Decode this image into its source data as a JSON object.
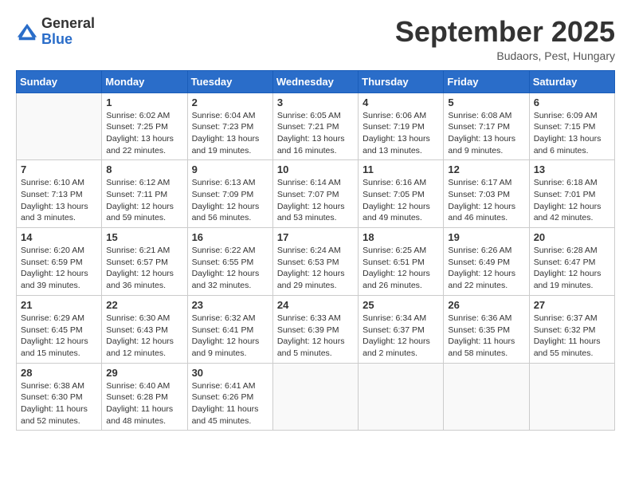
{
  "header": {
    "logo_general": "General",
    "logo_blue": "Blue",
    "month_title": "September 2025",
    "subtitle": "Budaors, Pest, Hungary"
  },
  "weekdays": [
    "Sunday",
    "Monday",
    "Tuesday",
    "Wednesday",
    "Thursday",
    "Friday",
    "Saturday"
  ],
  "weeks": [
    [
      {
        "day": "",
        "sunrise": "",
        "sunset": "",
        "daylight": ""
      },
      {
        "day": "1",
        "sunrise": "6:02 AM",
        "sunset": "7:25 PM",
        "daylight": "13 hours and 22 minutes."
      },
      {
        "day": "2",
        "sunrise": "6:04 AM",
        "sunset": "7:23 PM",
        "daylight": "13 hours and 19 minutes."
      },
      {
        "day": "3",
        "sunrise": "6:05 AM",
        "sunset": "7:21 PM",
        "daylight": "13 hours and 16 minutes."
      },
      {
        "day": "4",
        "sunrise": "6:06 AM",
        "sunset": "7:19 PM",
        "daylight": "13 hours and 13 minutes."
      },
      {
        "day": "5",
        "sunrise": "6:08 AM",
        "sunset": "7:17 PM",
        "daylight": "13 hours and 9 minutes."
      },
      {
        "day": "6",
        "sunrise": "6:09 AM",
        "sunset": "7:15 PM",
        "daylight": "13 hours and 6 minutes."
      }
    ],
    [
      {
        "day": "7",
        "sunrise": "6:10 AM",
        "sunset": "7:13 PM",
        "daylight": "13 hours and 3 minutes."
      },
      {
        "day": "8",
        "sunrise": "6:12 AM",
        "sunset": "7:11 PM",
        "daylight": "12 hours and 59 minutes."
      },
      {
        "day": "9",
        "sunrise": "6:13 AM",
        "sunset": "7:09 PM",
        "daylight": "12 hours and 56 minutes."
      },
      {
        "day": "10",
        "sunrise": "6:14 AM",
        "sunset": "7:07 PM",
        "daylight": "12 hours and 53 minutes."
      },
      {
        "day": "11",
        "sunrise": "6:16 AM",
        "sunset": "7:05 PM",
        "daylight": "12 hours and 49 minutes."
      },
      {
        "day": "12",
        "sunrise": "6:17 AM",
        "sunset": "7:03 PM",
        "daylight": "12 hours and 46 minutes."
      },
      {
        "day": "13",
        "sunrise": "6:18 AM",
        "sunset": "7:01 PM",
        "daylight": "12 hours and 42 minutes."
      }
    ],
    [
      {
        "day": "14",
        "sunrise": "6:20 AM",
        "sunset": "6:59 PM",
        "daylight": "12 hours and 39 minutes."
      },
      {
        "day": "15",
        "sunrise": "6:21 AM",
        "sunset": "6:57 PM",
        "daylight": "12 hours and 36 minutes."
      },
      {
        "day": "16",
        "sunrise": "6:22 AM",
        "sunset": "6:55 PM",
        "daylight": "12 hours and 32 minutes."
      },
      {
        "day": "17",
        "sunrise": "6:24 AM",
        "sunset": "6:53 PM",
        "daylight": "12 hours and 29 minutes."
      },
      {
        "day": "18",
        "sunrise": "6:25 AM",
        "sunset": "6:51 PM",
        "daylight": "12 hours and 26 minutes."
      },
      {
        "day": "19",
        "sunrise": "6:26 AM",
        "sunset": "6:49 PM",
        "daylight": "12 hours and 22 minutes."
      },
      {
        "day": "20",
        "sunrise": "6:28 AM",
        "sunset": "6:47 PM",
        "daylight": "12 hours and 19 minutes."
      }
    ],
    [
      {
        "day": "21",
        "sunrise": "6:29 AM",
        "sunset": "6:45 PM",
        "daylight": "12 hours and 15 minutes."
      },
      {
        "day": "22",
        "sunrise": "6:30 AM",
        "sunset": "6:43 PM",
        "daylight": "12 hours and 12 minutes."
      },
      {
        "day": "23",
        "sunrise": "6:32 AM",
        "sunset": "6:41 PM",
        "daylight": "12 hours and 9 minutes."
      },
      {
        "day": "24",
        "sunrise": "6:33 AM",
        "sunset": "6:39 PM",
        "daylight": "12 hours and 5 minutes."
      },
      {
        "day": "25",
        "sunrise": "6:34 AM",
        "sunset": "6:37 PM",
        "daylight": "12 hours and 2 minutes."
      },
      {
        "day": "26",
        "sunrise": "6:36 AM",
        "sunset": "6:35 PM",
        "daylight": "11 hours and 58 minutes."
      },
      {
        "day": "27",
        "sunrise": "6:37 AM",
        "sunset": "6:32 PM",
        "daylight": "11 hours and 55 minutes."
      }
    ],
    [
      {
        "day": "28",
        "sunrise": "6:38 AM",
        "sunset": "6:30 PM",
        "daylight": "11 hours and 52 minutes."
      },
      {
        "day": "29",
        "sunrise": "6:40 AM",
        "sunset": "6:28 PM",
        "daylight": "11 hours and 48 minutes."
      },
      {
        "day": "30",
        "sunrise": "6:41 AM",
        "sunset": "6:26 PM",
        "daylight": "11 hours and 45 minutes."
      },
      {
        "day": "",
        "sunrise": "",
        "sunset": "",
        "daylight": ""
      },
      {
        "day": "",
        "sunrise": "",
        "sunset": "",
        "daylight": ""
      },
      {
        "day": "",
        "sunrise": "",
        "sunset": "",
        "daylight": ""
      },
      {
        "day": "",
        "sunrise": "",
        "sunset": "",
        "daylight": ""
      }
    ]
  ]
}
